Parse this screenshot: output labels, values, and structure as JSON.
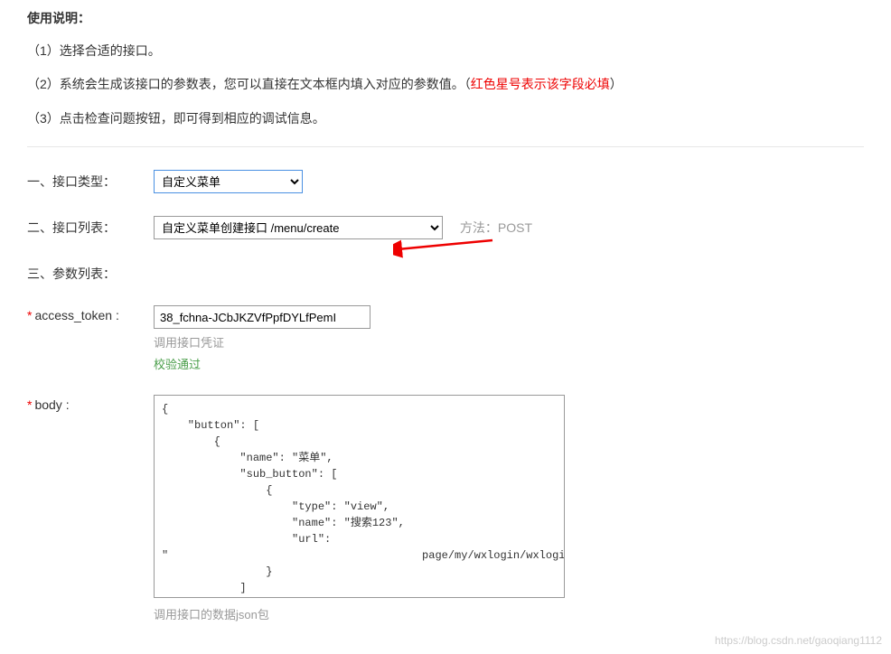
{
  "instructions": {
    "title": "使用说明：",
    "line1": "（1）选择合适的接口。",
    "line2_prefix": "（2）系统会生成该接口的参数表，您可以直接在文本框内填入对应的参数值。（",
    "line2_red": "红色星号表示该字段必填",
    "line2_suffix": "）",
    "line3": "（3）点击检查问题按钮，即可得到相应的调试信息。"
  },
  "form": {
    "type_label": "一、接口类型：",
    "type_value": "自定义菜单",
    "list_label": "二、接口列表：",
    "list_value": "自定义菜单创建接口 /menu/create",
    "method_label": "方法：POST",
    "params_label": "三、参数列表：",
    "token_label": "access_token :",
    "token_value": "38_fchna-JCbJKZVfPpfDYLfPemI",
    "token_hint": "调用接口凭证",
    "token_success": "校验通过",
    "body_label": "body :",
    "body_value": "{\n    \"button\": [\n        {\n            \"name\": \"菜单\",\n            \"sub_button\": [\n                {\n                    \"type\": \"view\",\n                    \"name\": \"搜索123\",\n                    \"url\":\n\"                                       page/my/wxlogin/wxlogin\"\n                }\n            ]\n        }\n    ]\n}",
    "body_hint": "调用接口的数据json包"
  },
  "watermark": "https://blog.csdn.net/gaoqiang1112"
}
